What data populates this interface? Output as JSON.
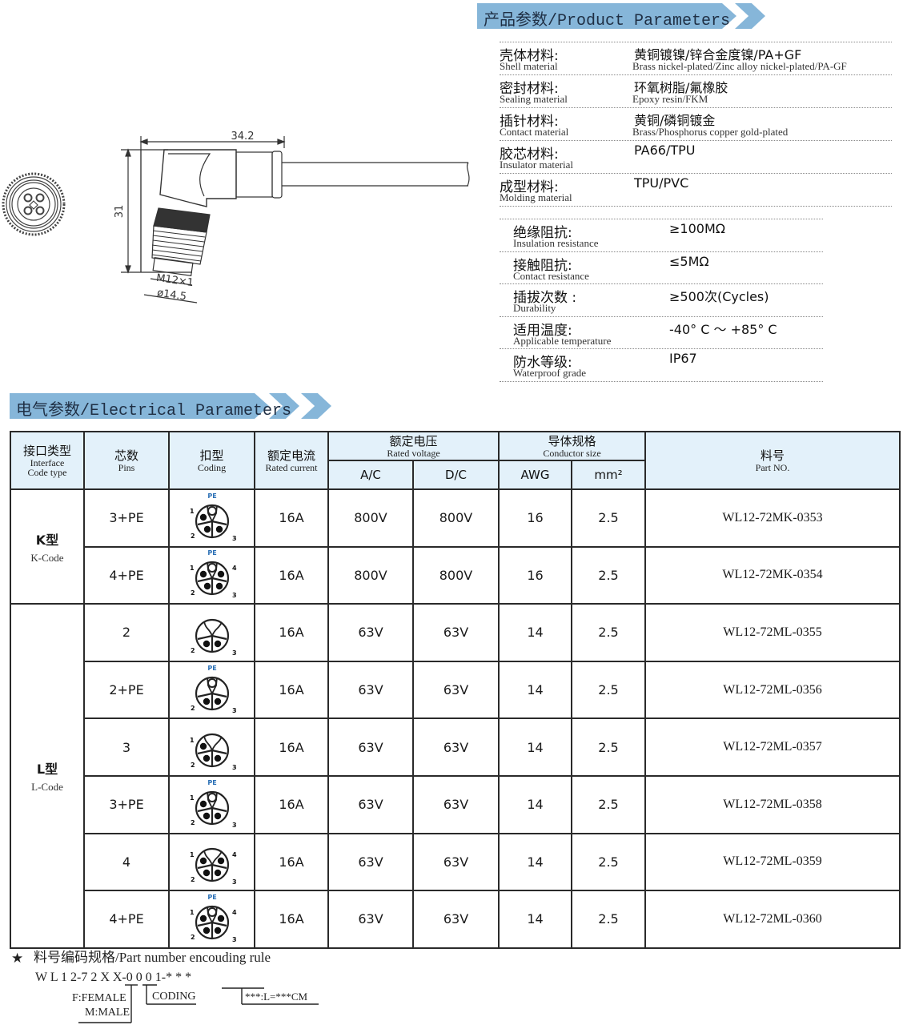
{
  "product_section": {
    "title_zh": "产品参数",
    "title_en": "/Product Parameters",
    "materials": [
      {
        "label_zh": "壳体材料:",
        "label_en": "Shell material",
        "value_zh": "黄铜镀镍/锌合金度镍/PA+GF",
        "value_en": "Brass nickel-plated/Zinc alloy nickel-plated/PA-GF"
      },
      {
        "label_zh": "密封材料:",
        "label_en": "Sealing material",
        "value_zh": "环氧树脂/氟橡胶",
        "value_en": "Epoxy resin/FKM"
      },
      {
        "label_zh": "插针材料:",
        "label_en": "Contact material",
        "value_zh": "黄铜/磷铜镀金",
        "value_en": "Brass/Phosphorus copper gold-plated"
      },
      {
        "label_zh": "胶芯材料:",
        "label_en": "Insulator material",
        "value_zh": "PA66/TPU",
        "value_en": ""
      },
      {
        "label_zh": "成型材料:",
        "label_en": "Molding material",
        "value_zh": "TPU/PVC",
        "value_en": ""
      }
    ],
    "performance": [
      {
        "label_zh": "绝缘阻抗:",
        "label_en": "Insulation resistance",
        "value": "≥100MΩ"
      },
      {
        "label_zh": "接触阻抗:",
        "label_en": "Contact resistance",
        "value": "≤5MΩ"
      },
      {
        "label_zh": "插拔次数 :",
        "label_en": "Durability",
        "value": "≥500次(Cycles)"
      },
      {
        "label_zh": "适用温度:",
        "label_en": "Applicable temperature",
        "value": "-40° C ～ +85° C"
      },
      {
        "label_zh": "防水等级:",
        "label_en": "Waterproof grade",
        "value": "IP67"
      }
    ]
  },
  "drawing": {
    "dim_width": "34.2",
    "dim_height": "31",
    "dim_thread": "M12×1",
    "dim_diameter": "ø14.5"
  },
  "electrical_section": {
    "title_zh": "电气参数",
    "title_en": "/Electrical Parameters",
    "headers": {
      "interface_zh": "接口类型",
      "interface_en1": "Interface",
      "interface_en2": "Code  type",
      "pins_zh": "芯数",
      "pins_en": "Pins",
      "coding_zh": "扣型",
      "coding_en": "Coding",
      "current_zh": "额定电流",
      "current_en": "Rated current",
      "voltage_zh": "额定电压",
      "voltage_en": "Rated voltage",
      "ac": "A/C",
      "dc": "D/C",
      "conductor_zh": "导体规格",
      "conductor_en": "Conductor size",
      "awg": "AWG",
      "mm2": "mm²",
      "part_zh": "料号",
      "part_en": "Part NO."
    },
    "groups": [
      {
        "code_zh": "K型",
        "code_en": "K-Code"
      },
      {
        "code_zh": "L型",
        "code_en": "L-Code"
      }
    ],
    "rows": [
      {
        "pins": "3+PE",
        "current": "16A",
        "ac": "800V",
        "dc": "800V",
        "awg": "16",
        "mm2": "2.5",
        "part": "WL12-72MK-0353"
      },
      {
        "pins": "4+PE",
        "current": "16A",
        "ac": "800V",
        "dc": "800V",
        "awg": "16",
        "mm2": "2.5",
        "part": "WL12-72MK-0354"
      },
      {
        "pins": "2",
        "current": "16A",
        "ac": "63V",
        "dc": "63V",
        "awg": "14",
        "mm2": "2.5",
        "part": "WL12-72ML-0355"
      },
      {
        "pins": "2+PE",
        "current": "16A",
        "ac": "63V",
        "dc": "63V",
        "awg": "14",
        "mm2": "2.5",
        "part": "WL12-72ML-0356"
      },
      {
        "pins": "3",
        "current": "16A",
        "ac": "63V",
        "dc": "63V",
        "awg": "14",
        "mm2": "2.5",
        "part": "WL12-72ML-0357"
      },
      {
        "pins": "3+PE",
        "current": "16A",
        "ac": "63V",
        "dc": "63V",
        "awg": "14",
        "mm2": "2.5",
        "part": "WL12-72ML-0358"
      },
      {
        "pins": "4",
        "current": "16A",
        "ac": "63V",
        "dc": "63V",
        "awg": "14",
        "mm2": "2.5",
        "part": "WL12-72ML-0359"
      },
      {
        "pins": "4+PE",
        "current": "16A",
        "ac": "63V",
        "dc": "63V",
        "awg": "14",
        "mm2": "2.5",
        "part": "WL12-72ML-0360"
      }
    ],
    "pin_diagrams": [
      {
        "style": "K",
        "pe": true,
        "labels": [
          "1",
          "2",
          "3"
        ]
      },
      {
        "style": "K",
        "pe": true,
        "labels": [
          "1",
          "2",
          "3",
          "4"
        ]
      },
      {
        "style": "L",
        "pe": false,
        "labels": [
          "2",
          "3"
        ]
      },
      {
        "style": "L",
        "pe": true,
        "labels": [
          "2",
          "3"
        ]
      },
      {
        "style": "L",
        "pe": false,
        "labels": [
          "1",
          "2",
          "3"
        ]
      },
      {
        "style": "L",
        "pe": true,
        "labels": [
          "1",
          "2",
          "3"
        ]
      },
      {
        "style": "L",
        "pe": false,
        "labels": [
          "1",
          "2",
          "3",
          "4"
        ]
      },
      {
        "style": "L",
        "pe": true,
        "labels": [
          "1",
          "2",
          "3",
          "4"
        ]
      }
    ],
    "pe_label": "PE"
  },
  "encoding_rule": {
    "star": "★",
    "title": "料号编码规格/Part number encouding rule",
    "code": "W L 1 2-7 2 X X-0 0 0 1-* * *",
    "note_gender_1": "F:FEMALE",
    "note_gender_2": "M:MALE",
    "note_coding": "CODING",
    "note_length": "***:L=***CM"
  },
  "colors": {
    "banner": "#86b6d9",
    "header_bg": "#e3f1fa",
    "pe_label": "#2a6fb5"
  }
}
